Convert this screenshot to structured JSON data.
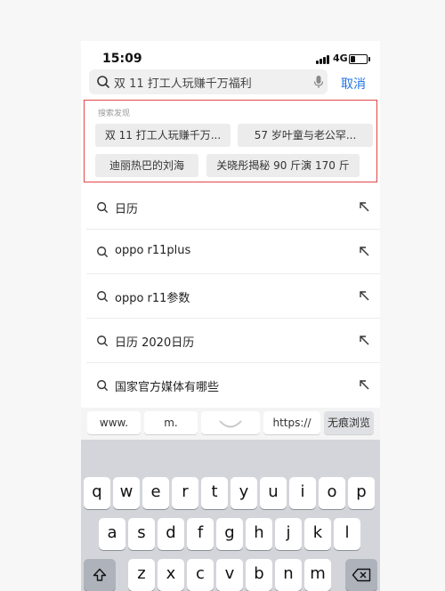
{
  "status_bar": {
    "time": "15:09",
    "network": "4G"
  },
  "search": {
    "query": "双 11 打工人玩赚千万福利",
    "cancel_label": "取消"
  },
  "discover": {
    "title": "搜索发现",
    "chips": [
      "双 11 打工人玩赚千万...",
      "57 岁叶童与老公罕...",
      "迪丽热巴的刘海",
      "关晓彤揭秘 90 斤演 170 斤"
    ]
  },
  "suggestions": [
    "日历",
    "oppo r11plus",
    "oppo r11参数",
    "日历 2020日历",
    "国家官方媒体有哪些"
  ],
  "quick_keys": [
    "www.",
    "m.",
    "",
    "https://",
    "无痕浏览"
  ],
  "keyboard": {
    "row1": [
      "q",
      "w",
      "e",
      "r",
      "t",
      "y",
      "u",
      "i",
      "o",
      "p"
    ],
    "row2": [
      "a",
      "s",
      "d",
      "f",
      "g",
      "h",
      "j",
      "k",
      "l"
    ],
    "row3": [
      "z",
      "x",
      "c",
      "v",
      "b",
      "n",
      "m"
    ]
  },
  "icons": [
    "search-icon",
    "mic-icon",
    "arrow-up-left-icon",
    "shift-icon",
    "backspace-icon"
  ]
}
